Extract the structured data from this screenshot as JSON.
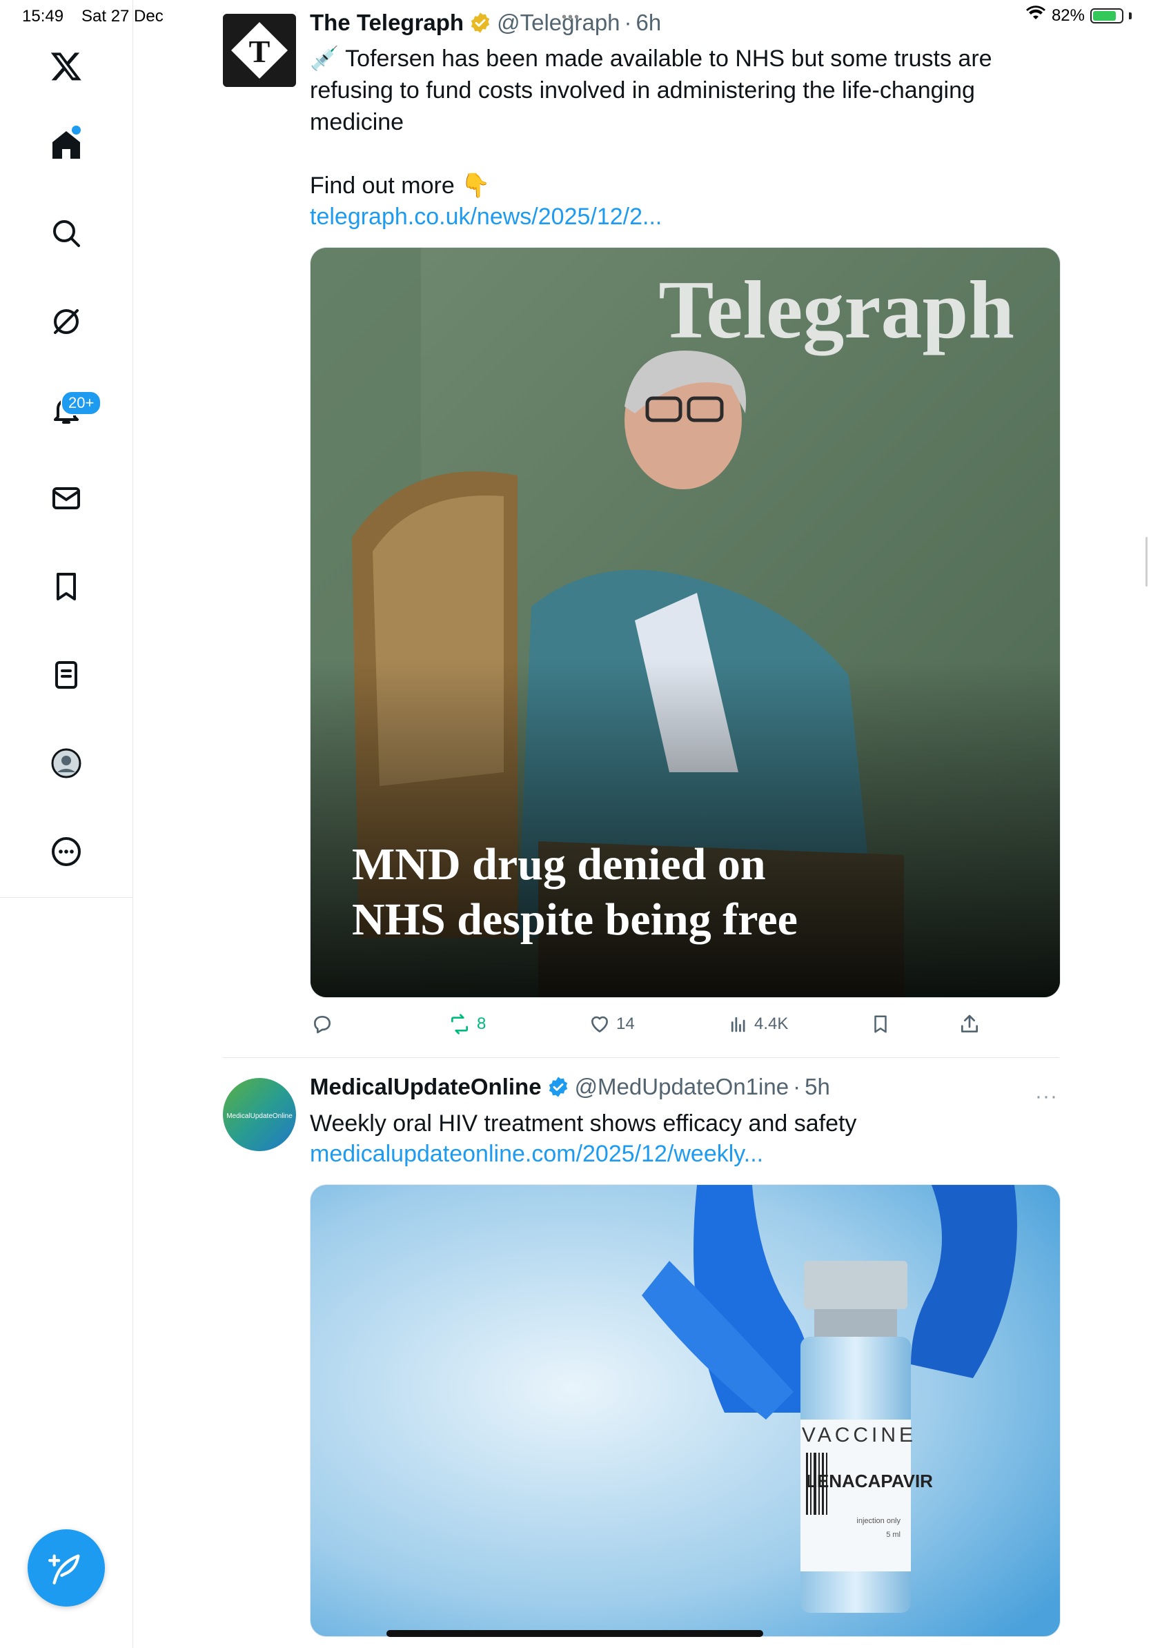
{
  "status_bar": {
    "time": "15:49",
    "date": "Sat 27 Dec",
    "battery": "82%",
    "battery_level": 0.82
  },
  "sidebar": {
    "notifications_badge": "20+",
    "items": [
      "x-logo",
      "home",
      "search",
      "grok",
      "notifications",
      "messages",
      "bookmarks",
      "lists",
      "profile",
      "more"
    ]
  },
  "tweets": [
    {
      "name": "The Telegraph",
      "handle": "@Telegraph",
      "sep": "·",
      "time": "6h",
      "text": "💉 Tofersen has been made available to NHS but some trusts are refusing to fund costs involved in administering the life-changing medicine\n\nFind out more 👇",
      "link": "telegraph.co.uk/news/2025/12/2...",
      "image": {
        "masthead": "Telegraph",
        "headline_line1": "MND drug denied on",
        "headline_line2": "NHS despite being free"
      },
      "actions": {
        "replies": "",
        "retweets": "8",
        "likes": "14",
        "views": "4.4K"
      }
    },
    {
      "name": "MedicalUpdateOnline",
      "handle": "@MedUpdateOn1ine",
      "sep": "·",
      "time": "5h",
      "more": "···",
      "avatar_text": "MedicalUpdateOnline",
      "text": "Weekly oral HIV treatment shows efficacy and safety",
      "link": "medicalupdateonline.com/2025/12/weekly...",
      "image": {
        "label_top": "VACCINE",
        "label_name": "LENACAPAVIR",
        "label_note": "injection only",
        "label_volume": "5 ml"
      }
    }
  ],
  "colors": {
    "accent": "#1d9bf0",
    "retweet": "#00ba7c",
    "muted": "#536471",
    "verified_gold": "#e8b923"
  }
}
